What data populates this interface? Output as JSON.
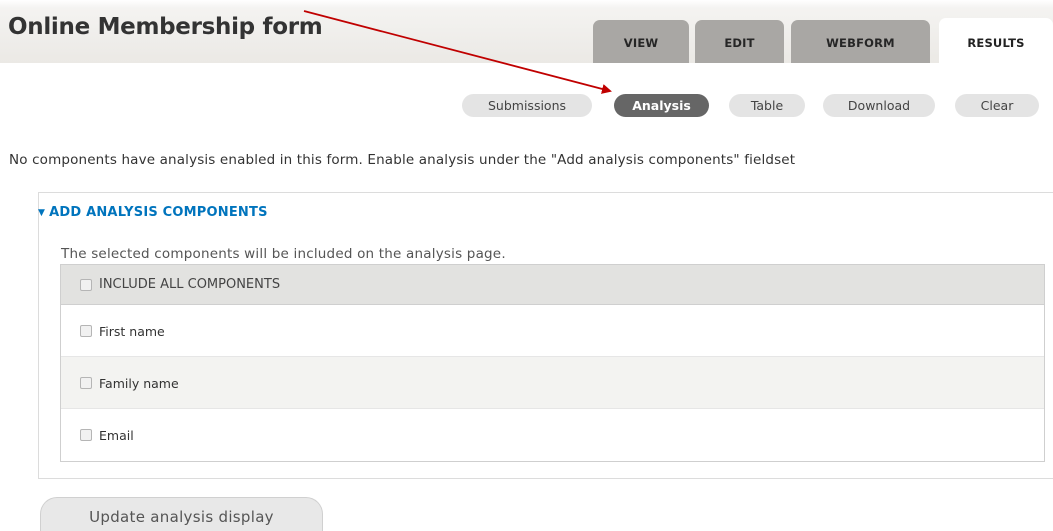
{
  "page": {
    "title": "Online Membership form",
    "notice": "No components have analysis enabled in this form. Enable analysis under the \"Add analysis components\" fieldset"
  },
  "primary_tabs": [
    {
      "label": "VIEW",
      "active": false
    },
    {
      "label": "EDIT",
      "active": false
    },
    {
      "label": "WEBFORM",
      "active": false
    },
    {
      "label": "RESULTS",
      "active": true
    }
  ],
  "secondary_tabs": [
    {
      "label": "Submissions",
      "active": false
    },
    {
      "label": "Analysis",
      "active": true
    },
    {
      "label": "Table",
      "active": false
    },
    {
      "label": "Download",
      "active": false
    },
    {
      "label": "Clear",
      "active": false
    }
  ],
  "fieldset": {
    "legend": "ADD ANALYSIS COMPONENTS",
    "description": "The selected components will be included on the analysis page.",
    "header_label": "INCLUDE ALL COMPONENTS",
    "components": [
      {
        "label": "First name",
        "checked": false
      },
      {
        "label": "Family name",
        "checked": false
      },
      {
        "label": "Email",
        "checked": false
      }
    ]
  },
  "actions": {
    "update_label": "Update analysis display"
  },
  "colors": {
    "link_blue": "#0074bd",
    "active_secondary_tab": "#666666",
    "inactive_primary_tab": "#a9a7a4",
    "annotation_arrow": "#c00000"
  }
}
